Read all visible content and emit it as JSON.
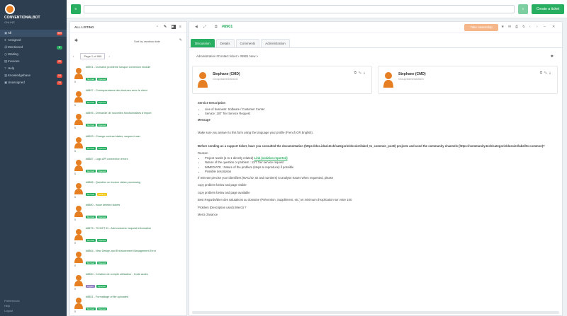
{
  "nav": {
    "brand": "CONVENTIONALBOT",
    "brand_sub": "ONLINE",
    "items": [
      {
        "label": "All",
        "badge": "999",
        "badge_color": "#e74c3c",
        "icon": "inbox-icon",
        "active": true
      },
      {
        "label": "Assigned",
        "badge": "",
        "badge_color": "",
        "icon": "user-icon",
        "active": false
      },
      {
        "label": "Mentioned",
        "badge": "8",
        "badge_color": "#27ae60",
        "icon": "at-icon",
        "active": false
      },
      {
        "label": "Waiting",
        "badge": "",
        "badge_color": "",
        "icon": "clock-icon",
        "active": false
      },
      {
        "label": "Invoices",
        "badge": "20",
        "badge_color": "#e74c3c",
        "icon": "file-icon",
        "active": false
      },
      {
        "label": "Help",
        "badge": "",
        "badge_color": "",
        "icon": "help-icon",
        "active": false
      },
      {
        "label": "Knowledgebase",
        "badge": "10",
        "badge_color": "#e74c3c",
        "icon": "book-icon",
        "active": false
      },
      {
        "label": "Unassigned",
        "badge": "70",
        "badge_color": "#e74c3c",
        "icon": "inbox-icon",
        "active": false
      }
    ],
    "footer": [
      "Preferences",
      "Help",
      "Logout"
    ]
  },
  "topbar": {
    "search_placeholder": "",
    "create_label": "Create a ticket",
    "left_btn": "≡"
  },
  "list": {
    "header": "ALL LISTING",
    "filter_label": "Sort by creation date",
    "sort_label": "Page 1 of 999",
    "tickets": [
      {
        "title": "#8901 - Domaine problème lorsque connexion module",
        "num": "5",
        "pills": [
          {
            "t": "Normal",
            "c": "#27ae60"
          },
          {
            "t": "Opened",
            "c": "#27ae60"
          }
        ]
      },
      {
        "title": "#8897 - Correspondance des factures avec le client",
        "num": "5",
        "pills": [
          {
            "t": "Normal",
            "c": "#27ae60"
          },
          {
            "t": "Opened",
            "c": "#27ae60"
          }
        ]
      },
      {
        "title": "#8895 - Demande de nouvelles fonctionnalités d'import",
        "num": "5",
        "pills": [
          {
            "t": "Normal",
            "c": "#27ae60"
          },
          {
            "t": "Opened",
            "c": "#27ae60"
          }
        ]
      },
      {
        "title": "#8893 - Change contract dates, suspend user",
        "num": "5",
        "pills": [
          {
            "t": "Normal",
            "c": "#27ae60"
          },
          {
            "t": "Opened",
            "c": "#27ae60"
          }
        ]
      },
      {
        "title": "#8887 - Logs API connection errors",
        "num": "5",
        "pills": [
          {
            "t": "Normal",
            "c": "#27ae60"
          },
          {
            "t": "Opened",
            "c": "#27ae60"
          }
        ]
      },
      {
        "title": "#8886 - Question on invoice dates processing",
        "num": "6",
        "pills": [
          {
            "t": "Normal",
            "c": "#27ae60"
          },
          {
            "t": "Waiting",
            "c": "#f1c40f"
          }
        ]
      },
      {
        "title": "#8880 - Issue deleted tickets",
        "num": "5",
        "pills": [
          {
            "t": "Normal",
            "c": "#27ae60"
          },
          {
            "t": "Opened",
            "c": "#27ae60"
          }
        ]
      },
      {
        "title": "#8875 - TICKET ID - Add customer request information",
        "num": "5",
        "pills": [
          {
            "t": "Normal",
            "c": "#27ae60"
          },
          {
            "t": "Opened",
            "c": "#27ae60"
          }
        ]
      },
      {
        "title": "#8864 - New Design and Enhancement Management Error",
        "num": "5",
        "pills": [
          {
            "t": "Normal",
            "c": "#27ae60"
          },
          {
            "t": "Opened",
            "c": "#27ae60"
          }
        ]
      },
      {
        "title": "#8860 - Création de compte utilisateur - Code accès",
        "num": "5",
        "pills": [
          {
            "t": "Urgent",
            "c": "#8e7cc3"
          },
          {
            "t": "Opened",
            "c": "#27ae60"
          }
        ]
      },
      {
        "title": "#8851 - Formattage of file uploaded",
        "num": "5",
        "pills": [
          {
            "t": "Normal",
            "c": "#27ae60"
          },
          {
            "t": "Opened",
            "c": "#27ae60"
          }
        ]
      }
    ]
  },
  "detail": {
    "ticket_id": "#8901",
    "action_label": "Take ownership",
    "tabs": [
      "Discussion",
      "Details",
      "Comments",
      "Administration"
    ],
    "breadcrumb": "Administration #Contact ticket > #8901 New >",
    "people": [
      {
        "name": "Stephane (CMD)",
        "sub": "Group/Administration"
      },
      {
        "name": "Stephane (CMD)",
        "sub": "Group/Administration"
      }
    ],
    "body": {
      "section": "Service Description",
      "bullets": [
        "Line of business: Software / Customer Center",
        "Service: 1ST Tier Service Request"
      ],
      "message_label": "Message",
      "intro": "Make sure you answer to this form using the language your profile (French OR English).",
      "notice": "Before sending us a support ticket, have you consulted the documentation (https://doc.ideal.tech/categorie/dossier/label_to_common_post/) projects and used the community channels (https://community.tech/categorie/dossier/label/to-common)?",
      "checklist_title": "Reason",
      "checklist": [
        "Project needs (1 to 1 directly related)",
        "Nature of the question or problem : 1ST Tier service request",
        "IMMEDIATE : Nature of the problem (steps to reproduce) if possible",
        "Possible description"
      ],
      "link_label": "Link (solution reported)",
      "paragraphs": [
        "If relevant precise your identifiers (MAC/ID, ID and numbers) to analyse issues when requested, please",
        "copy problem below and page visible",
        "copy problem below and page available",
        "Best Regards/Bien des salutations au domaine (Prévention, Supplément, etc.) et minimum d'explication sur votre 100",
        "Problem (Description used) (Merci) ?",
        "Merci d'avance"
      ]
    }
  }
}
